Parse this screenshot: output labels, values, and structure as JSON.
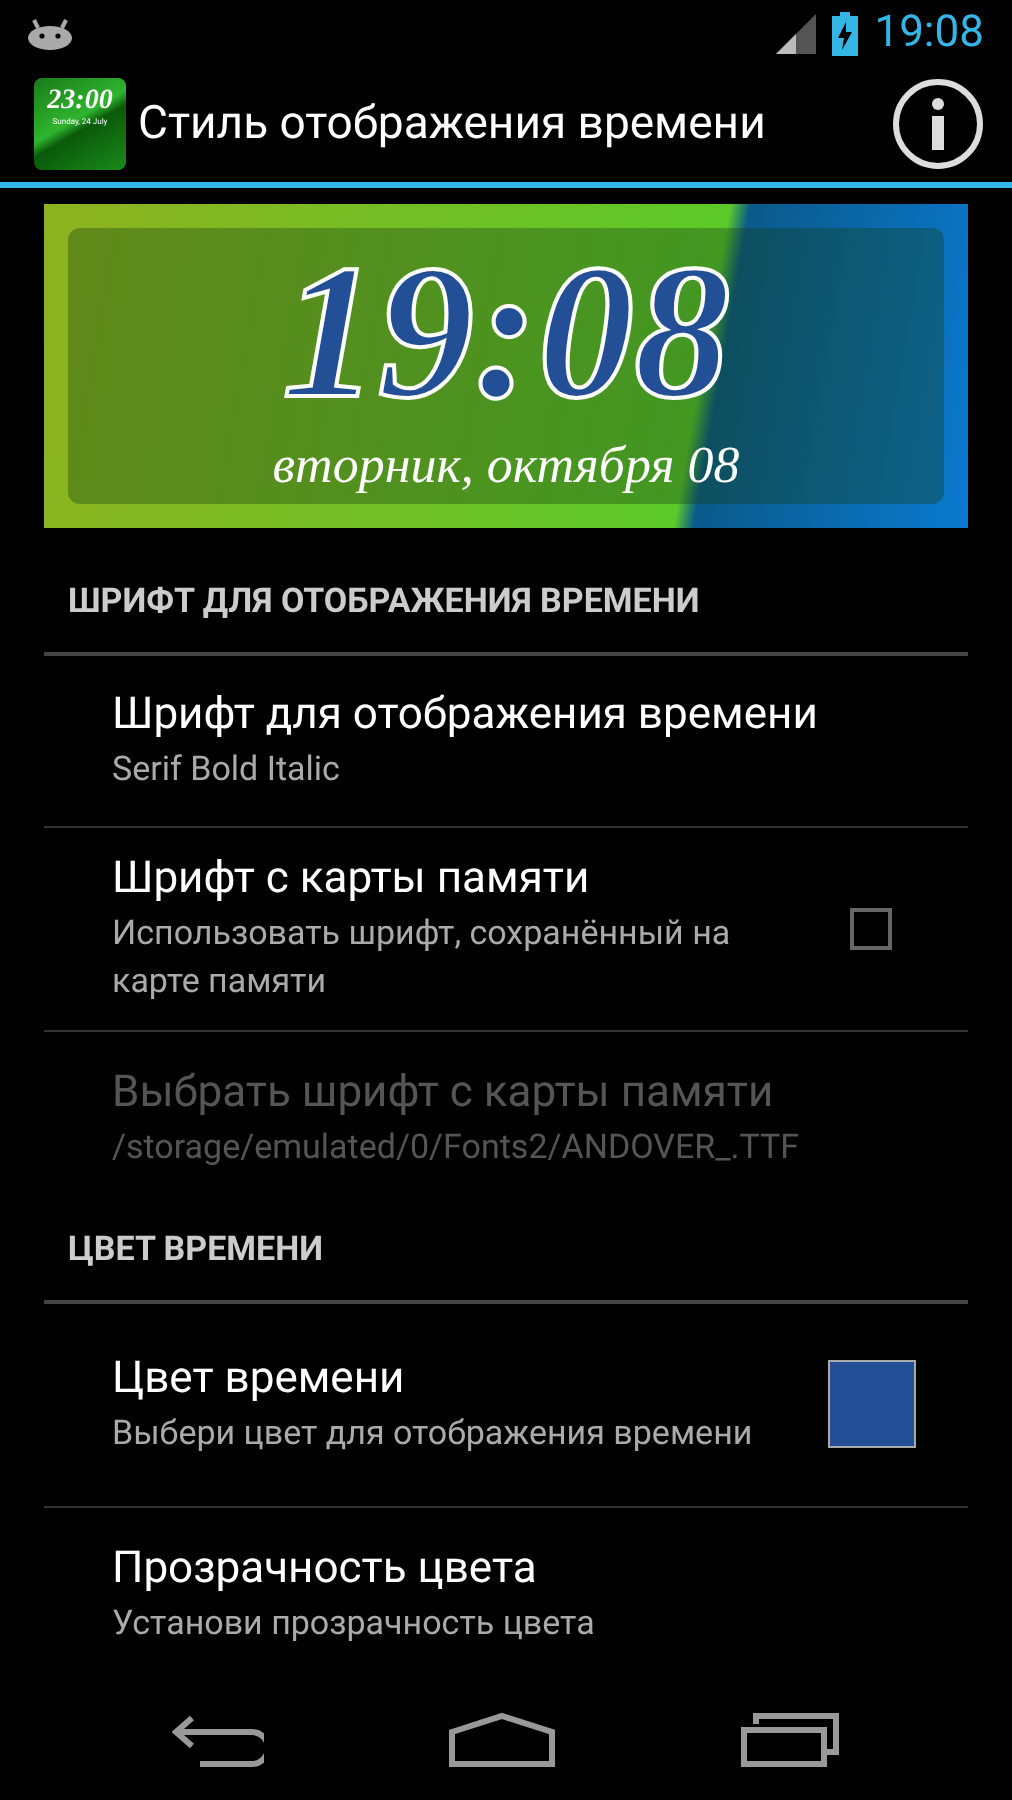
{
  "status_bar": {
    "time": "19:08"
  },
  "action_bar": {
    "app_icon": {
      "time": "23:00",
      "date": "Sunday, 24 July"
    },
    "title": "Стиль отображения времени"
  },
  "preview": {
    "time": "19:08",
    "date": "вторник, октября 08"
  },
  "sections": [
    {
      "header": "ШРИФТ ДЛЯ ОТОБРАЖЕНИЯ ВРЕМЕНИ",
      "items": [
        {
          "kind": "plain",
          "title": "Шрифт для отображения времени",
          "summary": "Serif Bold Italic",
          "disabled": false
        },
        {
          "kind": "checkbox",
          "title": "Шрифт с карты памяти",
          "summary": "Использовать шрифт, сохранённый на карте памяти",
          "checked": false,
          "disabled": false
        },
        {
          "kind": "plain",
          "title": "Выбрать шрифт с карты памяти",
          "summary": "/storage/emulated/0/Fonts2/ANDOVER_.TTF",
          "disabled": true
        }
      ]
    },
    {
      "header": "ЦВЕТ ВРЕМЕНИ",
      "items": [
        {
          "kind": "color",
          "title": "Цвет времени",
          "summary": "Выбери цвет для отображения времени",
          "color": "#234f97",
          "disabled": false
        },
        {
          "kind": "plain",
          "title": "Прозрачность цвета",
          "summary": "Установи прозрачность цвета",
          "disabled": false
        }
      ]
    }
  ]
}
